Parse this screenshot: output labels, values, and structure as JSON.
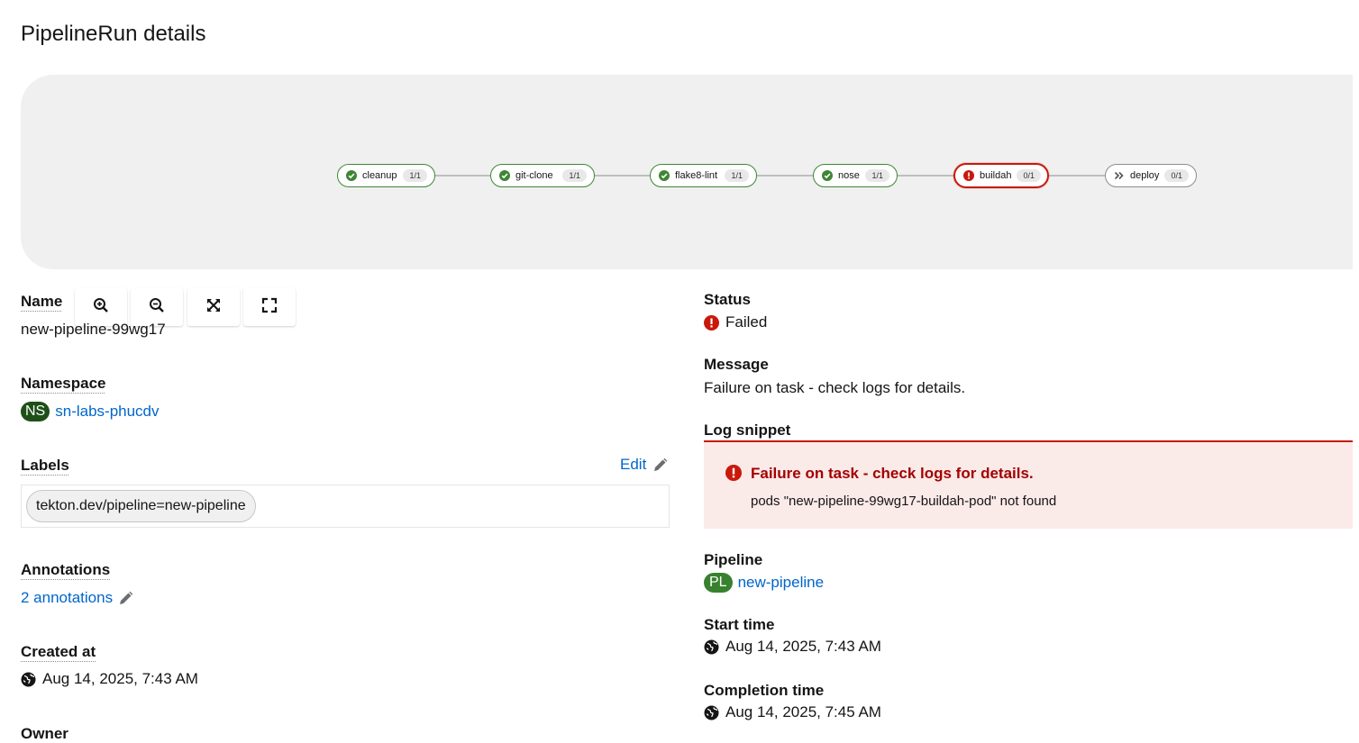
{
  "page": {
    "title": "PipelineRun details"
  },
  "topology": {
    "tasks": [
      {
        "name": "cleanup",
        "count": "1/1",
        "status": "succeeded"
      },
      {
        "name": "git-clone",
        "count": "1/1",
        "status": "succeeded"
      },
      {
        "name": "flake8-lint",
        "count": "1/1",
        "status": "succeeded"
      },
      {
        "name": "nose",
        "count": "1/1",
        "status": "succeeded"
      },
      {
        "name": "buildah",
        "count": "0/1",
        "status": "failed"
      },
      {
        "name": "deploy",
        "count": "0/1",
        "status": "pending"
      }
    ],
    "controls": [
      {
        "name": "zoom-in",
        "icon": "zoom-in-icon"
      },
      {
        "name": "zoom-out",
        "icon": "zoom-out-icon"
      },
      {
        "name": "fit-to-screen",
        "icon": "expand-arrows-icon"
      },
      {
        "name": "reset-view",
        "icon": "fullscreen-icon"
      }
    ]
  },
  "details": {
    "name": {
      "label": "Name",
      "value": "new-pipeline-99wg17"
    },
    "namespace": {
      "label": "Namespace",
      "badge": "NS",
      "value": "sn-labs-phucdv"
    },
    "labels": {
      "label": "Labels",
      "edit": "Edit",
      "items": [
        "tekton.dev/pipeline=new-pipeline"
      ]
    },
    "annotations": {
      "label": "Annotations",
      "value": "2 annotations"
    },
    "created_at": {
      "label": "Created at",
      "value": "Aug 14, 2025, 7:43 AM"
    },
    "owner": {
      "label": "Owner"
    }
  },
  "status_panel": {
    "status": {
      "label": "Status",
      "value": "Failed"
    },
    "message": {
      "label": "Message",
      "value": "Failure on task - check logs for details."
    },
    "log_snippet": {
      "label": "Log snippet",
      "title": "Failure on task - check logs for details.",
      "detail": "pods \"new-pipeline-99wg17-buildah-pod\" not found"
    },
    "pipeline": {
      "label": "Pipeline",
      "badge": "PL",
      "value": "new-pipeline"
    },
    "start_time": {
      "label": "Start time",
      "value": "Aug 14, 2025, 7:43 AM"
    },
    "completion_time": {
      "label": "Completion time",
      "value": "Aug 14, 2025, 7:45 AM"
    }
  },
  "colors": {
    "success": "#3e8635",
    "danger": "#c9190b",
    "link": "#0066cc",
    "ns_badge": "#1e4f18",
    "pl_badge": "#38812f"
  }
}
